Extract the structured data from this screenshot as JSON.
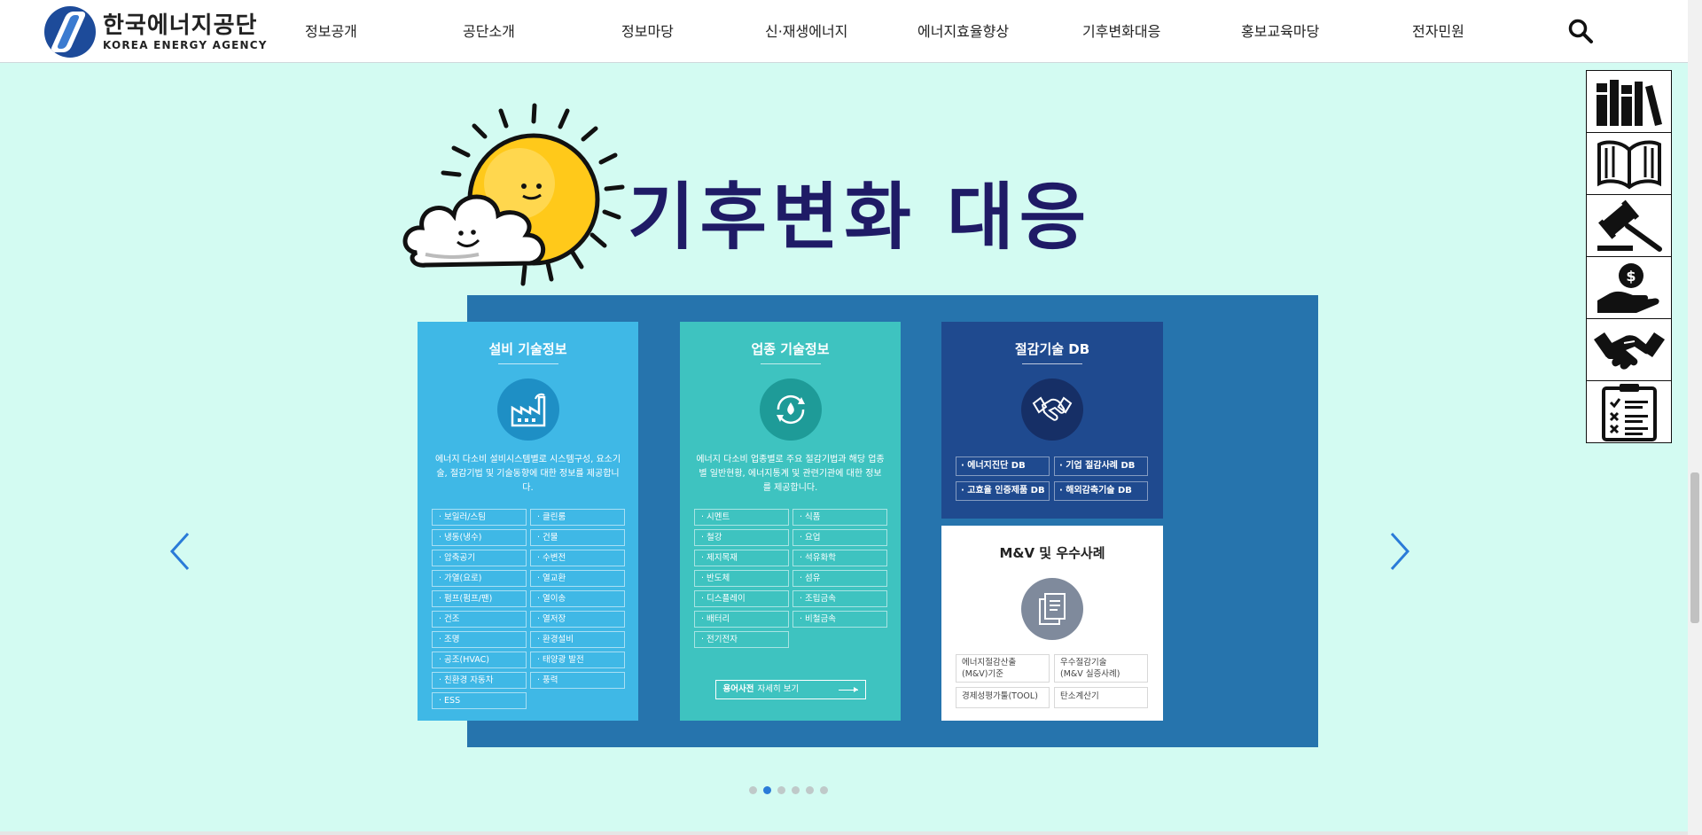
{
  "header": {
    "logo_ko": "한국에너지공단",
    "logo_en": "KOREA ENERGY AGENCY",
    "nav": [
      "정보공개",
      "공단소개",
      "정보마당",
      "신·재생에너지",
      "에너지효율향상",
      "기후변화대응",
      "홍보교육마당",
      "전자민원"
    ]
  },
  "hero": {
    "title": "기후변화 대응"
  },
  "quick_menu": [
    "books-icon",
    "open-book-icon",
    "gavel-icon",
    "money-hand-icon",
    "handshake-icon",
    "checklist-icon"
  ],
  "cards": {
    "facility": {
      "title": "설비 기술정보",
      "desc": "에너지 다소비 설비시스템별로 시스템구성, 요소기술, 절감기법 및 기술동향에 대한 정보를 제공합니다.",
      "items": [
        "보일러/스팀",
        "클린룸",
        "냉동(냉수)",
        "건물",
        "압축공기",
        "수변전",
        "가열(요로)",
        "열교환",
        "펌프(펌프/팬)",
        "열이송",
        "건조",
        "열저장",
        "조명",
        "환경설비",
        "공조(HVAC)",
        "태양광 발전",
        "친환경 자동차",
        "풍력",
        "ESS"
      ]
    },
    "industry": {
      "title": "업종 기술정보",
      "desc": "에너지 다소비 업종별로 주요 절감기법과 해당 업종별 일반현황, 에너지통계 및 관련기관에 대한 정보를 제공합니다.",
      "items": [
        "시멘트",
        "식품",
        "철강",
        "요업",
        "제지목재",
        "석유화학",
        "반도체",
        "섬유",
        "디스플레이",
        "조립금속",
        "배터리",
        "비철금속",
        "전기전자"
      ],
      "dict_bold": "용어사전",
      "dict_label": "자세히 보기"
    },
    "saving_db": {
      "title": "절감기술 DB",
      "items": [
        "에너지진단 DB",
        "기업 절감사례 DB",
        "고효율 인증제품 DB",
        "해외감축기술 DB"
      ]
    },
    "mv": {
      "title": "M&V 및 우수사례",
      "items": [
        "에너지절감산출\n(M&V)기준",
        "우수절감기술\n(M&V 실증사례)",
        "경제성평가툴(TOOL)",
        "탄소계산기"
      ]
    }
  },
  "carousel": {
    "slide_count": 6,
    "active_index": 1
  },
  "colors": {
    "page_bg": "#d3fbf2",
    "title": "#1f1b66",
    "slide_bg": "#2674ad",
    "card_sky": "#3fb8e6",
    "card_teal": "#3ec3c0",
    "card_navy": "#1f4a8f"
  }
}
